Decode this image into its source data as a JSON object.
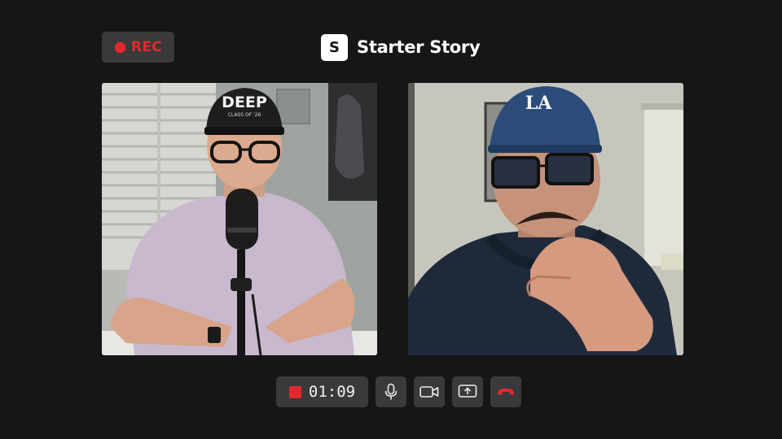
{
  "header": {
    "rec_label": "REC",
    "brand_logo_letter": "S",
    "brand_name": "Starter Story"
  },
  "participants": [
    {
      "position": "left",
      "hat_text": "DEEP",
      "hat_subtext": "CLASS OF '26"
    },
    {
      "position": "right",
      "hat_text": "LA"
    }
  ],
  "call_controls": {
    "timer": "01:09",
    "buttons": [
      "microphone",
      "camera",
      "share-screen",
      "end-call"
    ]
  },
  "colors": {
    "background": "#161616",
    "control_bg": "#3a3a3a",
    "rec_red": "#e0292f",
    "text": "#ffffff"
  }
}
